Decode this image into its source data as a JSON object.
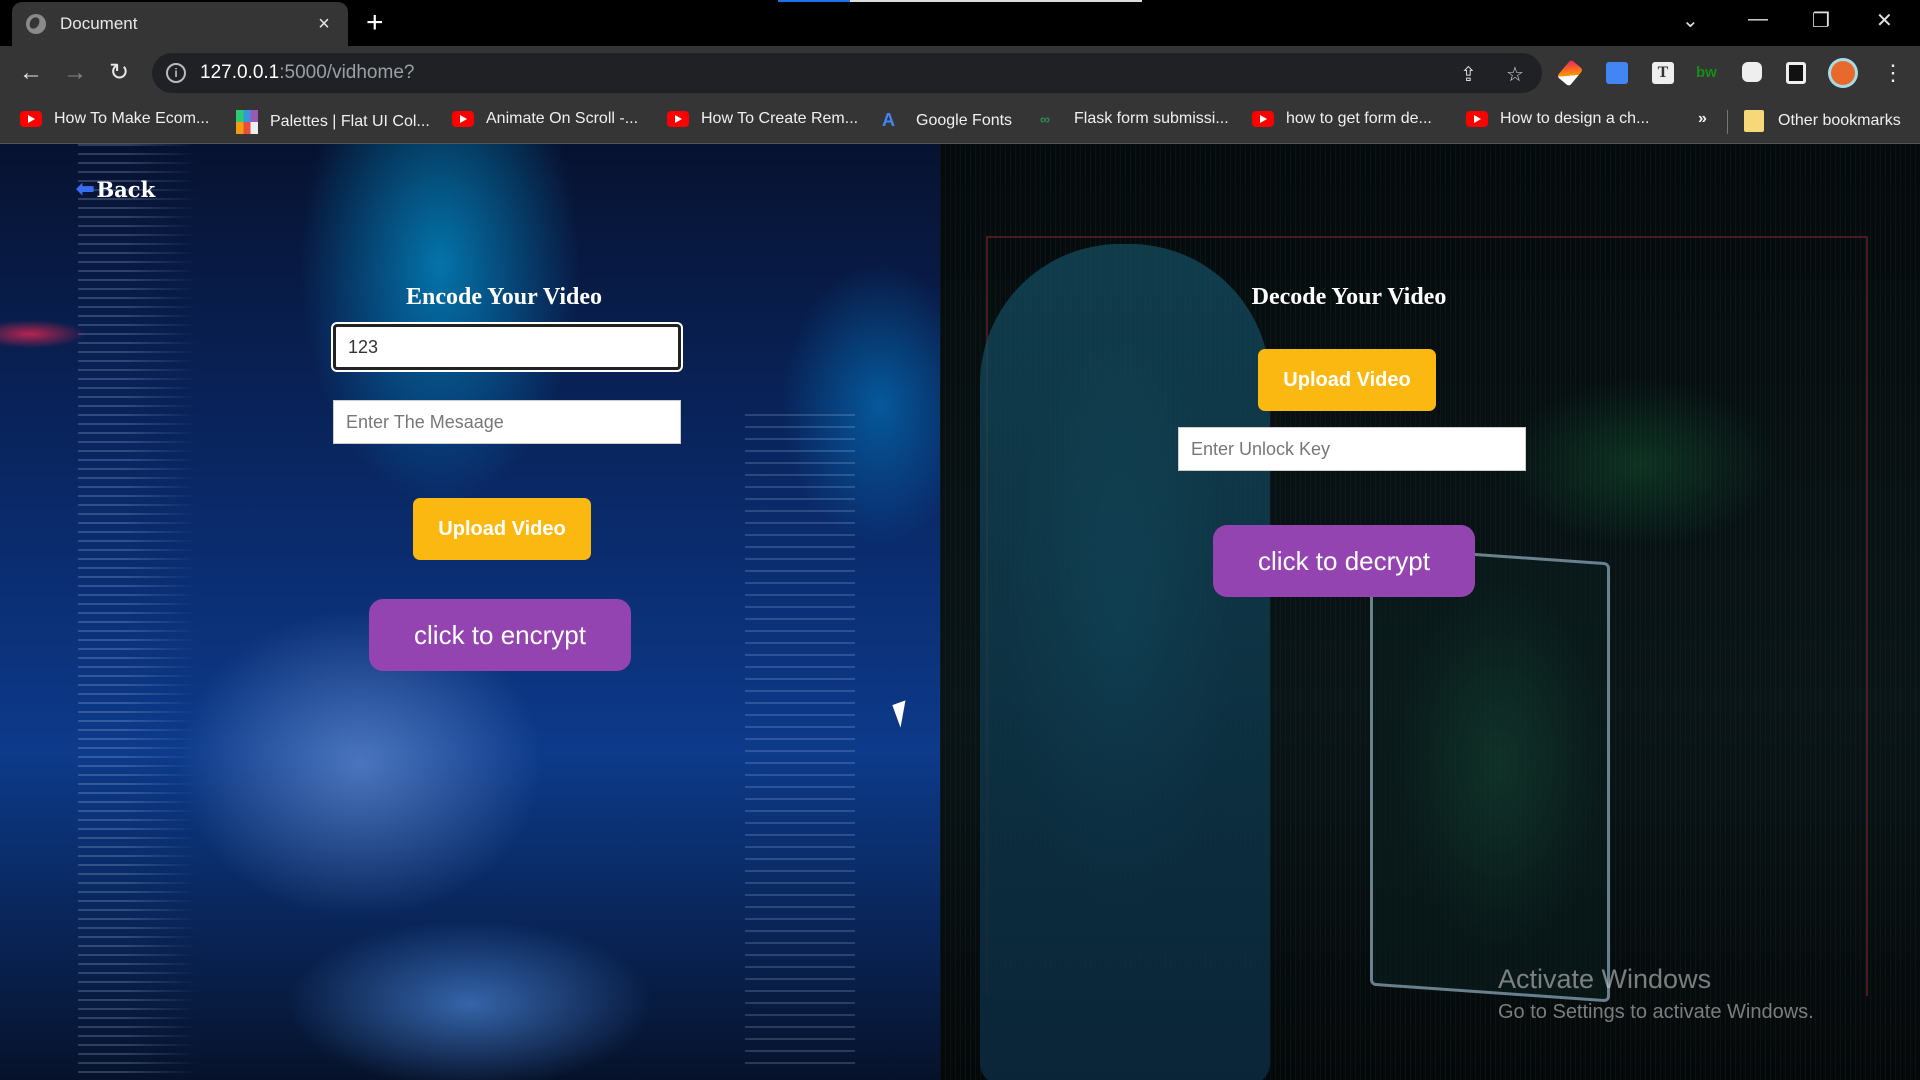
{
  "browser": {
    "tab": {
      "title": "Document",
      "close_glyph": "×",
      "icon": "globe-icon"
    },
    "new_tab_glyph": "+",
    "window_controls": {
      "dropdown": "⌄",
      "minimize": "—",
      "restore": "❐",
      "close": "✕"
    },
    "nav": {
      "back": "←",
      "forward": "→",
      "reload": "↻"
    },
    "address": {
      "host": "127.0.0.1",
      "path": ":5000/vidhome?",
      "info_glyph": "i"
    },
    "omnibox_icons": {
      "share": "⇪",
      "bookmark_star": "☆"
    },
    "extensions": [
      "color-picker-icon",
      "google-translate-icon",
      "text-icon",
      "bw-icon",
      "extensions-puzzle-icon",
      "side-panel-icon",
      "profile-avatar-icon",
      "menu-kebab-icon"
    ],
    "bookmarks": [
      {
        "icon": "youtube-icon",
        "label": "How To Make Ecom..."
      },
      {
        "icon": "palette-icon",
        "label": "Palettes | Flat UI Col..."
      },
      {
        "icon": "youtube-icon",
        "label": "Animate On Scroll -..."
      },
      {
        "icon": "youtube-icon",
        "label": "How To Create Rem..."
      },
      {
        "icon": "google-fonts-icon",
        "label": "Google Fonts"
      },
      {
        "icon": "geeksforgeeks-icon",
        "label": "Flask form submissi..."
      },
      {
        "icon": "youtube-icon",
        "label": "how to get form de..."
      },
      {
        "icon": "youtube-icon",
        "label": "How to design a ch..."
      }
    ],
    "bookmarks_overflow": "»",
    "other_bookmarks": "Other bookmarks"
  },
  "page": {
    "back_link": {
      "arrow": "⬅",
      "label": "Back"
    },
    "encode": {
      "title": "Encode Your Video",
      "key_input": {
        "value": "123",
        "placeholder": ""
      },
      "message_input": {
        "value": "",
        "placeholder": "Enter The Mesaage"
      },
      "upload_label": "Upload Video",
      "action_label": "click to encrypt"
    },
    "decode": {
      "title": "Decode Your Video",
      "upload_label": "Upload Video",
      "key_input": {
        "value": "",
        "placeholder": "Enter Unlock Key"
      },
      "action_label": "click to decrypt"
    },
    "colors": {
      "upload_button": "#fbb810",
      "action_button": "#9444b0"
    }
  },
  "os_overlay": {
    "activate_title": "Activate Windows",
    "activate_subtitle": "Go to Settings to activate Windows."
  }
}
